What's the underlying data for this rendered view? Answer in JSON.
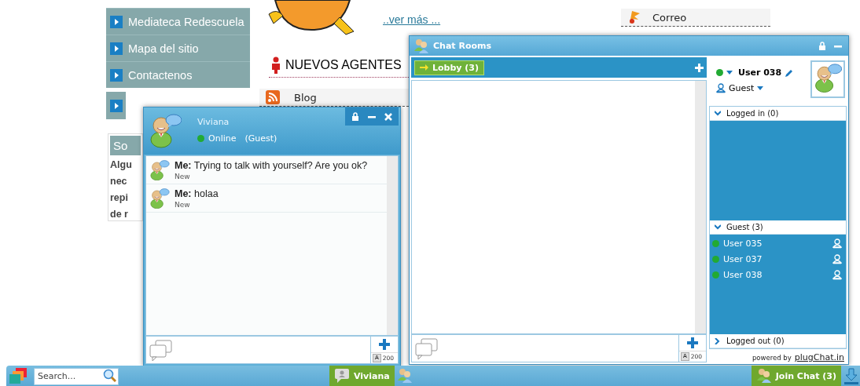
{
  "site": {
    "menu": [
      {
        "label": "Mediateca Redescuela"
      },
      {
        "label": "Mapa del sitio"
      },
      {
        "label": "Contactenos"
      }
    ],
    "side_card": {
      "title": "So",
      "lines": [
        "Algu",
        "nec",
        "repi",
        "de r"
      ]
    },
    "more_link": "..ver más ...",
    "section_heading": "NUEVOS AGENTES",
    "links": [
      {
        "label": "Blog",
        "kind": "rss"
      }
    ],
    "right_links": [
      {
        "label": "Correo",
        "kind": "flag"
      }
    ]
  },
  "private_chat": {
    "name": "Viviana",
    "online": true,
    "status": "Online",
    "role": "(Guest)",
    "messages": [
      {
        "text": "**Me:** Trying to talk with yourself? Are you ok?",
        "status": "New"
      },
      {
        "text": "**Me:** holaa",
        "status": "New"
      }
    ],
    "font_button": "A",
    "char_limit": "200"
  },
  "chat_rooms": {
    "title": "Chat Rooms",
    "tabs": [
      {
        "label": "Lobby (3)",
        "selected": true
      }
    ],
    "font_button": "A",
    "char_limit": "200",
    "me": {
      "name": "User 038",
      "online": true,
      "role": "Guest"
    },
    "groups": [
      {
        "label": "Logged in (0)",
        "expanded": true
      },
      {
        "label": "Guest (3)",
        "expanded": true,
        "users": [
          {
            "name": "User 035",
            "online": true
          },
          {
            "name": "User 037",
            "online": true
          },
          {
            "name": "User 038",
            "online": true
          }
        ]
      },
      {
        "label": "Logged out (0)",
        "expanded": false
      }
    ],
    "powered_by": "powered by",
    "brand_link": "plugChat.in"
  },
  "taskbar": {
    "search": {
      "placeholder": "Search..."
    },
    "windows": [
      {
        "label": "Viviana",
        "kind": "chat"
      }
    ],
    "join_button": "Join Chat (3)"
  }
}
